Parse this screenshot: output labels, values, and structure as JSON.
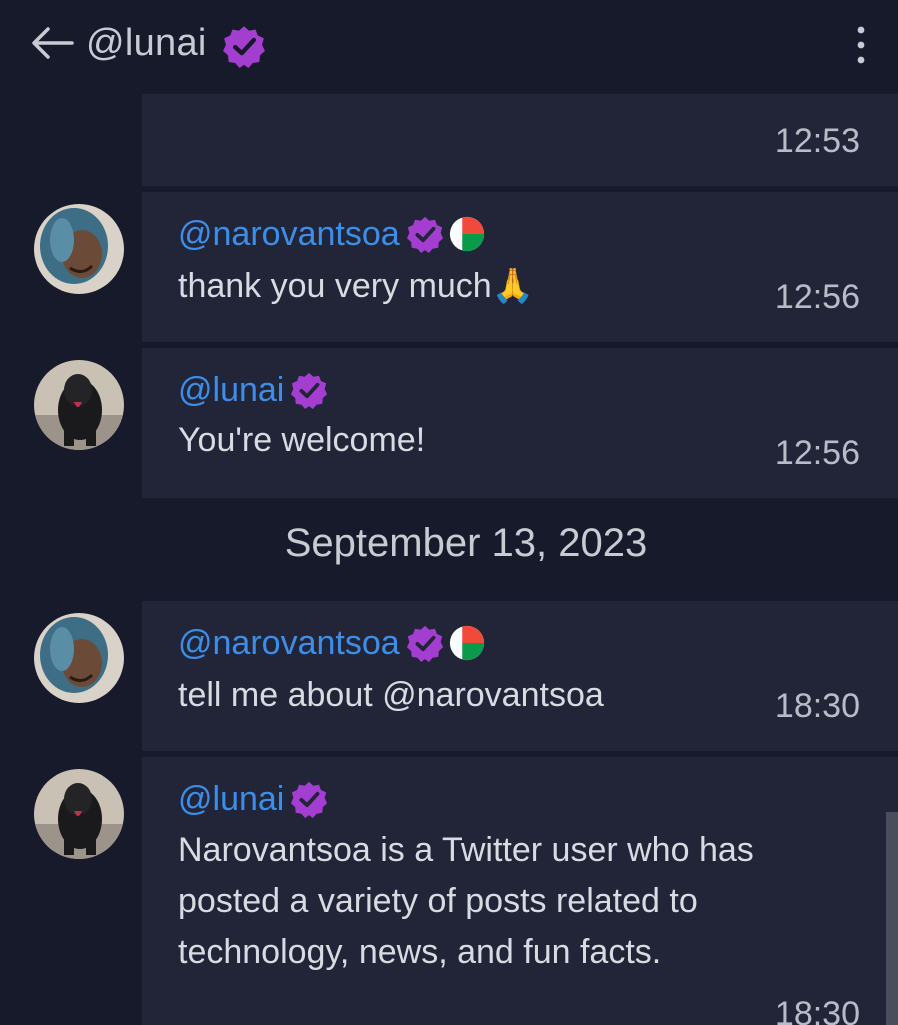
{
  "header": {
    "title": "@lunai",
    "back_icon": "arrow-left-icon",
    "badge_icon": "verified-badge-icon",
    "menu_icon": "more-vertical-icon"
  },
  "colors": {
    "background": "#171a2a",
    "panel": "#222538",
    "handle": "#3d8ee8",
    "verified": "#a43ed1"
  },
  "messages": [
    {
      "time": "12:53"
    },
    {
      "handle": "@narovantsoa",
      "text": "thank you very much🙏",
      "time": "12:56",
      "flag": "madagascar-flag-icon"
    },
    {
      "handle": "@lunai",
      "text": "You're welcome!",
      "time": "12:56"
    },
    {
      "handle": "@narovantsoa",
      "text": "tell me about @narovantsoa",
      "time": "18:30",
      "flag": "madagascar-flag-icon"
    },
    {
      "handle": "@lunai",
      "text": "Narovantsoa is a Twitter user who has posted a variety of posts related to technology, news, and fun facts.",
      "time": "18:30"
    }
  ],
  "date_separator": "September 13, 2023"
}
